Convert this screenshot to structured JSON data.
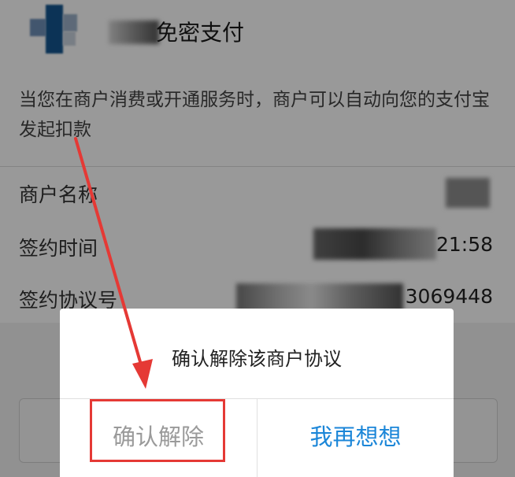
{
  "header": {
    "title": "免密支付"
  },
  "description": "当您在商户消费或开通服务时，商户可以自动向您的支付宝发起扣款",
  "rows": [
    {
      "label": "商户名称",
      "value": ""
    },
    {
      "label": "签约时间",
      "value": "21:58"
    },
    {
      "label": "签约协议号",
      "value": "3069448"
    }
  ],
  "dialog": {
    "message": "确认解除该商户协议",
    "confirm_label": "确认解除",
    "cancel_label": "我再想想"
  },
  "colors": {
    "cancel_accent": "#1b86d8",
    "annotation_red": "#e53935"
  }
}
